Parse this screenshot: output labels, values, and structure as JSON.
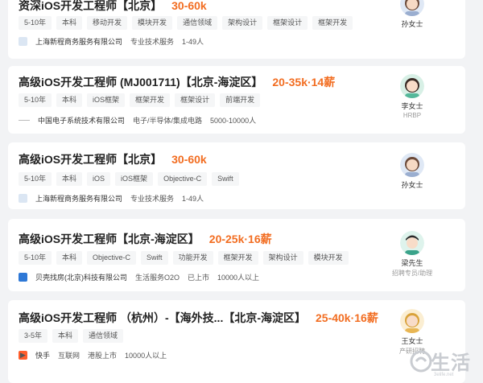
{
  "jobs": [
    {
      "title": "资深iOS开发工程师【北京】",
      "salary": "30-60k",
      "tags": [
        "5-10年",
        "本科",
        "移动开发",
        "模块开发",
        "通信领域",
        "架构设计",
        "框架设计",
        "框架开发"
      ],
      "company_name": "上海新程商务服务有限公司",
      "company_info": [
        "专业技术服务",
        "1-49人"
      ],
      "recruiter_name": "孙女士",
      "recruiter_role": ""
    },
    {
      "title": "高级iOS开发工程师 (MJ001711)【北京-海淀区】",
      "salary": "20-35k·14薪",
      "tags": [
        "5-10年",
        "本科",
        "iOS框架",
        "框架开发",
        "框架设计",
        "前端开发"
      ],
      "company_name": "中国电子系统技术有限公司",
      "company_info": [
        "电子/半导体/集成电路",
        "5000-10000人"
      ],
      "recruiter_name": "李女士",
      "recruiter_role": "HRBP"
    },
    {
      "title": "高级iOS开发工程师【北京】",
      "salary": "30-60k",
      "tags": [
        "5-10年",
        "本科",
        "iOS",
        "iOS框架",
        "Objective-C",
        "Swift"
      ],
      "company_name": "上海新程商务服务有限公司",
      "company_info": [
        "专业技术服务",
        "1-49人"
      ],
      "recruiter_name": "孙女士",
      "recruiter_role": ""
    },
    {
      "title": "高级iOS开发工程师【北京-海淀区】",
      "salary": "20-25k·16薪",
      "tags": [
        "5-10年",
        "本科",
        "Objective-C",
        "Swift",
        "功能开发",
        "框架开发",
        "架构设计",
        "模块开发"
      ],
      "company_name": "贝壳找房(北京)科技有限公司",
      "company_info": [
        "生活服务O2O",
        "已上市",
        "10000人以上"
      ],
      "recruiter_name": "梁先生",
      "recruiter_role": "招聘专员/助理"
    },
    {
      "title": "高级iOS开发工程师 （杭州）-【海外技...【北京-海淀区】",
      "salary": "25-40k·16薪",
      "tags": [
        "3-5年",
        "本科",
        "通信领域"
      ],
      "company_name": "快手",
      "company_info": [
        "互联网",
        "港股上市",
        "10000人以上"
      ],
      "recruiter_name": "王女士",
      "recruiter_role": "产研招聘"
    }
  ],
  "watermark": {
    "text": "生活",
    "url": "3elife.net"
  },
  "colors": {
    "salary": "#f26d21",
    "background": "#f2f3f5",
    "card": "#ffffff"
  }
}
